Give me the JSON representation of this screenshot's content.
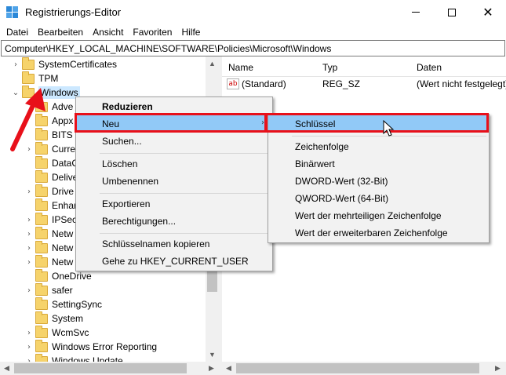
{
  "window": {
    "title": "Registrierungs-Editor",
    "minimize_glyph": "",
    "close_glyph": "✕"
  },
  "menubar": {
    "items": [
      "Datei",
      "Bearbeiten",
      "Ansicht",
      "Favoriten",
      "Hilfe"
    ]
  },
  "address": {
    "path": "Computer\\HKEY_LOCAL_MACHINE\\SOFTWARE\\Policies\\Microsoft\\Windows"
  },
  "tree": {
    "items": [
      {
        "label": "SystemCertificates",
        "expander": "›"
      },
      {
        "label": "TPM",
        "expander": ""
      },
      {
        "label": "Windows",
        "expander": "⌄",
        "selected": true
      },
      {
        "label": "Adve",
        "expander": ""
      },
      {
        "label": "Appx",
        "expander": ""
      },
      {
        "label": "BITS",
        "expander": ""
      },
      {
        "label": "Curre",
        "expander": "›"
      },
      {
        "label": "DataC",
        "expander": ""
      },
      {
        "label": "Delive",
        "expander": ""
      },
      {
        "label": "Drive",
        "expander": "›"
      },
      {
        "label": "Enhar",
        "expander": ""
      },
      {
        "label": "IPSec",
        "expander": "›"
      },
      {
        "label": "Netw",
        "expander": "›"
      },
      {
        "label": "Netw",
        "expander": "›"
      },
      {
        "label": "Netw",
        "expander": "›"
      },
      {
        "label": "OneDrive",
        "expander": ""
      },
      {
        "label": "safer",
        "expander": "›"
      },
      {
        "label": "SettingSync",
        "expander": ""
      },
      {
        "label": "System",
        "expander": ""
      },
      {
        "label": "WcmSvc",
        "expander": "›"
      },
      {
        "label": "Windows Error Reporting",
        "expander": "›"
      },
      {
        "label": "Windows Update",
        "expander": "›"
      }
    ]
  },
  "list": {
    "columns": [
      "Name",
      "Typ",
      "Daten"
    ],
    "rows": [
      {
        "icon": "ab",
        "name": "(Standard)",
        "type": "REG_SZ",
        "data": "(Wert nicht festgelegt)"
      }
    ]
  },
  "context_menu": {
    "items": [
      {
        "label": "Reduzieren",
        "bold": true
      },
      {
        "label": "Neu",
        "submenu": true,
        "highlighted": true,
        "arrow": "›"
      },
      {
        "label": "Suchen..."
      },
      {
        "separator": true
      },
      {
        "label": "Löschen"
      },
      {
        "label": "Umbenennen"
      },
      {
        "separator": true
      },
      {
        "label": "Exportieren"
      },
      {
        "label": "Berechtigungen..."
      },
      {
        "separator": true
      },
      {
        "label": "Schlüsselnamen kopieren"
      },
      {
        "label": "Gehe zu HKEY_CURRENT_USER"
      }
    ]
  },
  "submenu": {
    "items": [
      {
        "label": "Schlüssel",
        "highlighted": true
      },
      {
        "separator": true
      },
      {
        "label": "Zeichenfolge"
      },
      {
        "label": "Binärwert"
      },
      {
        "label": "DWORD-Wert (32-Bit)"
      },
      {
        "label": "QWORD-Wert (64-Bit)"
      },
      {
        "label": "Wert der mehrteiligen Zeichenfolge"
      },
      {
        "label": "Wert der erweiterbaren Zeichenfolge"
      }
    ]
  },
  "colors": {
    "highlight": "#91c9f7",
    "annotation_red": "#e8101a",
    "folder": "#f6d36b"
  }
}
